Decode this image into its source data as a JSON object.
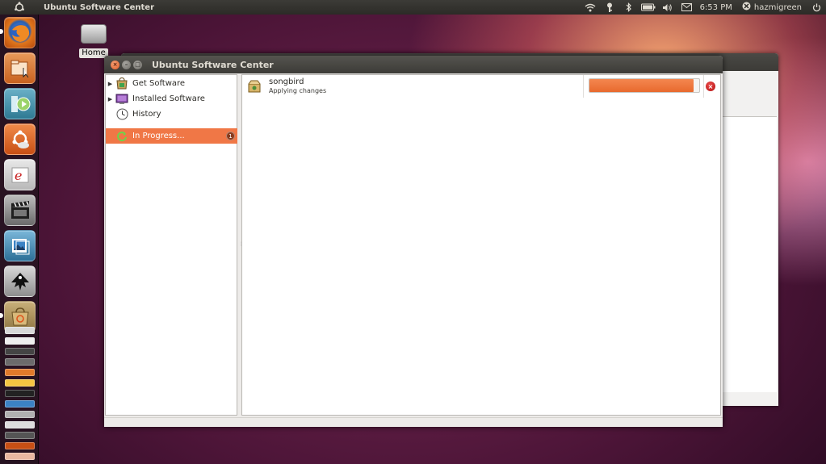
{
  "top_panel": {
    "app_title": "Ubuntu Software Center",
    "clock": "6:53 PM",
    "username": "hazmigreen"
  },
  "desktop": {
    "icons": [
      {
        "label": "Home",
        "icon": "drive-icon"
      }
    ]
  },
  "launcher": {
    "items": [
      "firefox",
      "files",
      "media-player",
      "ubuntu-one",
      "evolution",
      "video-editor",
      "image-viewer",
      "inkscape",
      "software-center"
    ]
  },
  "window": {
    "title": "Ubuntu Software Center",
    "sidebar": {
      "items": [
        {
          "label": "Get Software",
          "icon": "get-software-icon"
        },
        {
          "label": "Installed Software",
          "icon": "installed-software-icon"
        },
        {
          "label": "History",
          "icon": "history-icon"
        },
        {
          "label": "In Progress...",
          "icon": "in-progress-icon",
          "badge": "1",
          "active": true
        }
      ]
    },
    "transactions": [
      {
        "name": "songbird",
        "status": "Applying changes",
        "progress": 0.95
      }
    ]
  },
  "colors": {
    "accent": "#f07746",
    "panel": "#3c3b37",
    "desktop_bg": "#4d1538"
  }
}
